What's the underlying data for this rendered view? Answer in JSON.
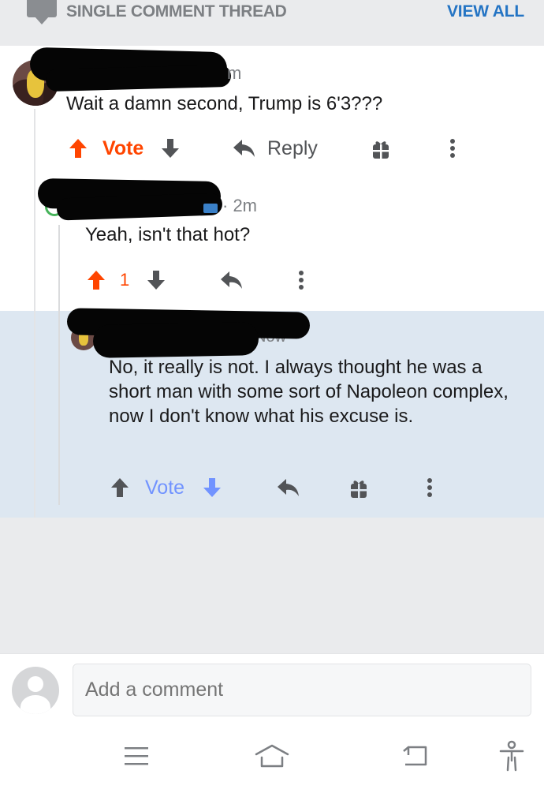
{
  "header": {
    "thread_title": "SINGLE COMMENT THREAD",
    "view_all": "VIEW ALL"
  },
  "comments": [
    {
      "meta_tail": "m",
      "body": "Wait a damn second, Trump is  6'3???",
      "vote_label": "Vote",
      "reply_label": "Reply",
      "upvoted": true
    },
    {
      "meta_tail": "· 2m",
      "body": "Yeah, isn't that hot?",
      "score": "1",
      "upvoted": true
    },
    {
      "meta_tail": "Now",
      "body": "No, it really is not. I always thought he was a short man with some sort of Napoleon complex, now I don't know what his excuse is.",
      "vote_label": "Vote",
      "highlighted": true
    }
  ],
  "composer": {
    "placeholder": "Add a comment"
  },
  "colors": {
    "upvote": "#ff4500",
    "downvote_highlight": "#7193ff",
    "link": "#2474c4",
    "highlight_bg": "#dde7f1"
  },
  "icons": [
    "chat-icon",
    "arrow-up-icon",
    "arrow-down-icon",
    "reply-icon",
    "gift-icon",
    "more-vertical-icon",
    "menu-icon",
    "home-icon",
    "back-icon",
    "accessibility-icon"
  ]
}
